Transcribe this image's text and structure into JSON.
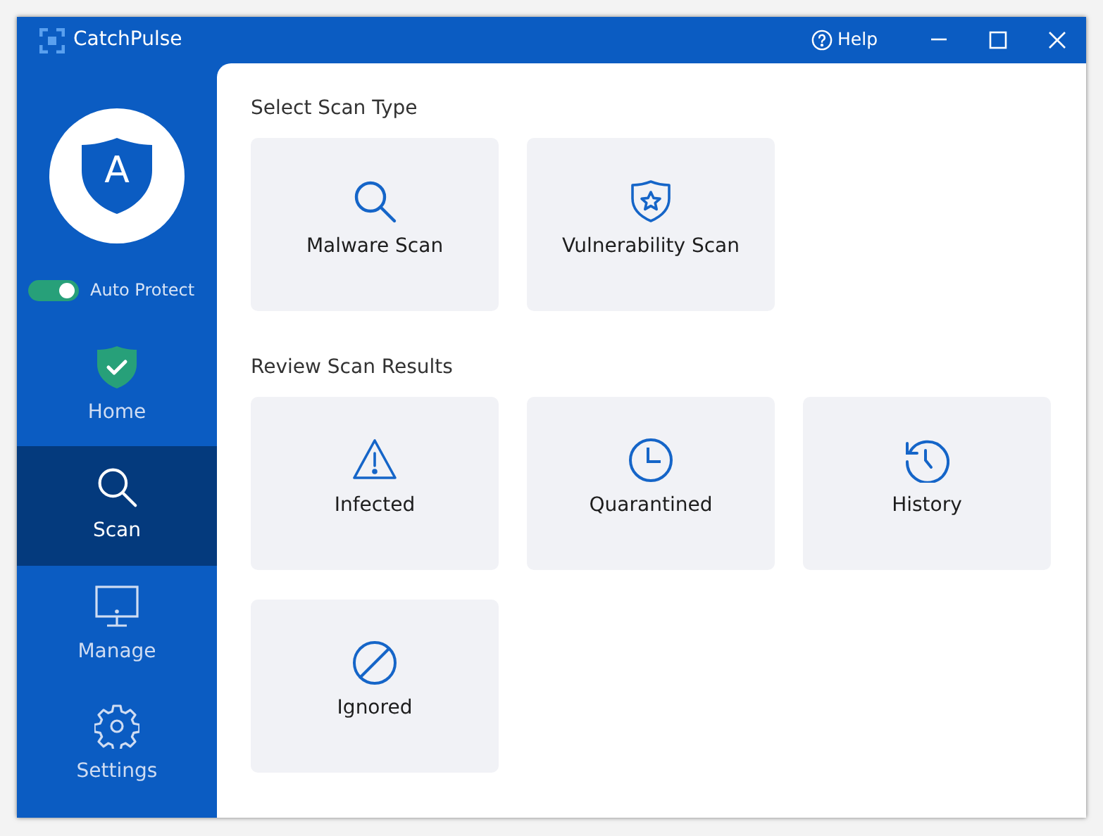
{
  "window": {
    "title": "CatchPulse",
    "help": "Help"
  },
  "logo": {
    "letter": "A"
  },
  "auto_protect": {
    "label": "Auto Protect",
    "on": true
  },
  "sidebar": {
    "items": [
      {
        "label": "Home",
        "selected": false
      },
      {
        "label": "Scan",
        "selected": true
      },
      {
        "label": "Manage",
        "selected": false
      },
      {
        "label": "Settings",
        "selected": false
      }
    ]
  },
  "sections": [
    {
      "title": "Select Scan Type",
      "tiles": [
        {
          "label": "Malware Scan"
        },
        {
          "label": "Vulnerability Scan"
        }
      ]
    },
    {
      "title": "Review Scan Results",
      "tiles": [
        {
          "label": "Infected"
        },
        {
          "label": "Quarantined"
        },
        {
          "label": "History"
        },
        {
          "label": "Ignored"
        }
      ]
    }
  ]
}
